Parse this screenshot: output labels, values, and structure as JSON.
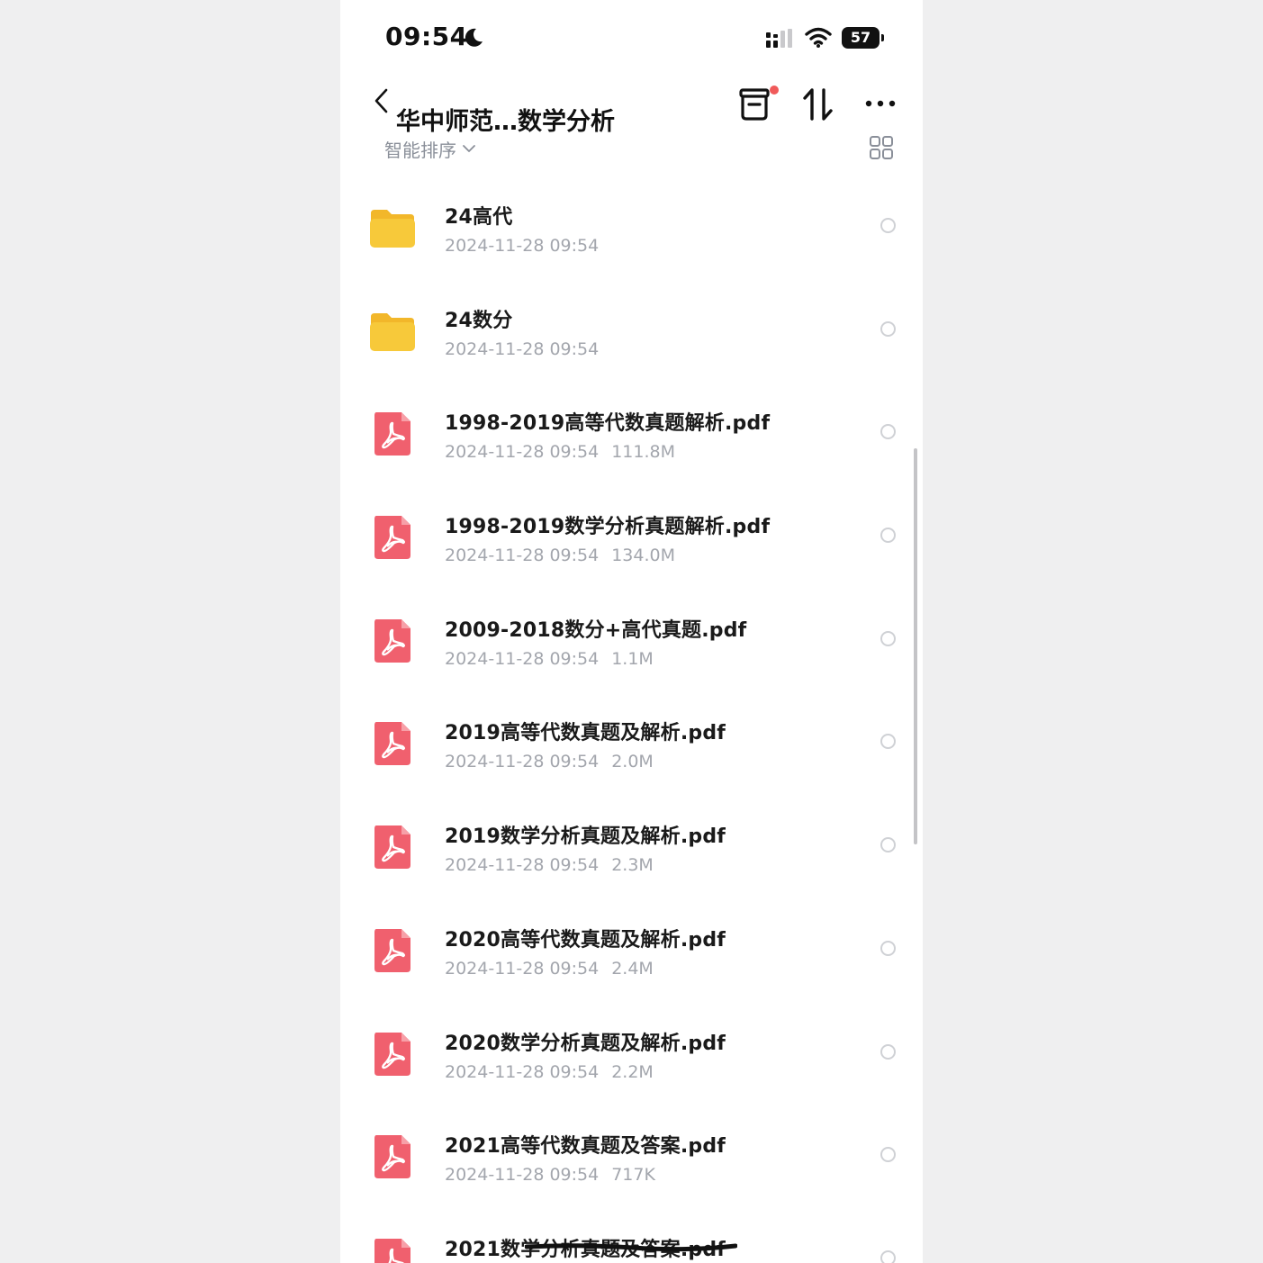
{
  "status_bar": {
    "time": "09:54",
    "battery": "57"
  },
  "header": {
    "title": "华中师范…数学分析",
    "sort_label": "智能排序"
  },
  "files": [
    {
      "name": "24高代",
      "date": "2024-11-28 09:54",
      "size": "",
      "type": "folder"
    },
    {
      "name": "24数分",
      "date": "2024-11-28 09:54",
      "size": "",
      "type": "folder"
    },
    {
      "name": "1998-2019高等代数真题解析.pdf",
      "date": "2024-11-28 09:54",
      "size": "111.8M",
      "type": "pdf"
    },
    {
      "name": "1998-2019数学分析真题解析.pdf",
      "date": "2024-11-28 09:54",
      "size": "134.0M",
      "type": "pdf"
    },
    {
      "name": "2009-2018数分+高代真题.pdf",
      "date": "2024-11-28 09:54",
      "size": "1.1M",
      "type": "pdf"
    },
    {
      "name": "2019高等代数真题及解析.pdf",
      "date": "2024-11-28 09:54",
      "size": "2.0M",
      "type": "pdf"
    },
    {
      "name": "2019数学分析真题及解析.pdf",
      "date": "2024-11-28 09:54",
      "size": "2.3M",
      "type": "pdf"
    },
    {
      "name": "2020高等代数真题及解析.pdf",
      "date": "2024-11-28 09:54",
      "size": "2.4M",
      "type": "pdf"
    },
    {
      "name": "2020数学分析真题及解析.pdf",
      "date": "2024-11-28 09:54",
      "size": "2.2M",
      "type": "pdf"
    },
    {
      "name": "2021高等代数真题及答案.pdf",
      "date": "2024-11-28 09:54",
      "size": "717K",
      "type": "pdf"
    },
    {
      "name": "2021数学分析真题及答案.pdf",
      "date": "",
      "size": "",
      "type": "pdf"
    }
  ],
  "colors": {
    "folder": "#f7c93a",
    "folder_tab": "#f2b72a",
    "pdf": "#f0606e",
    "notification_dot": "#f05a5a",
    "meta_text": "#a3a6ad"
  },
  "icons": {
    "back": "chevron-left-icon",
    "trash": "trash-icon",
    "sort": "sort-arrows-icon",
    "more": "more-horizontal-icon",
    "grid": "grid-view-icon",
    "folder": "folder-icon",
    "pdf": "pdf-icon"
  }
}
